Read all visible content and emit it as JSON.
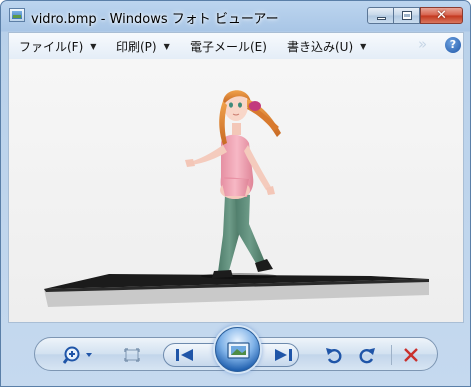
{
  "window": {
    "title": "vidro.bmp - Windows フォト ビューアー",
    "close_glyph": "✕"
  },
  "menu": {
    "items": [
      {
        "label": "ファイル(F)",
        "icon": "chevron-down-icon"
      },
      {
        "label": "印刷(P)",
        "icon": "chevron-down-icon"
      },
      {
        "label": "電子メール(E)"
      },
      {
        "label": "書き込み(U)",
        "icon": "chevron-down-icon"
      }
    ],
    "more_glyph": "»",
    "help_glyph": "?"
  },
  "toolbar": {
    "icons": [
      "zoom-icon",
      "actual-size-icon",
      "previous-icon",
      "slideshow-icon",
      "next-icon",
      "rotate-left-icon",
      "rotate-right-icon",
      "delete-icon"
    ]
  },
  "colors": {
    "frame": "#bcd5ef",
    "close_button": "#d7624d",
    "toolbar_icon": "#1f55a8",
    "delete_icon": "#c9302c",
    "outfit": "#f2a4b4",
    "stockings": "#5e8e7a",
    "hair": "#e38a3a"
  }
}
